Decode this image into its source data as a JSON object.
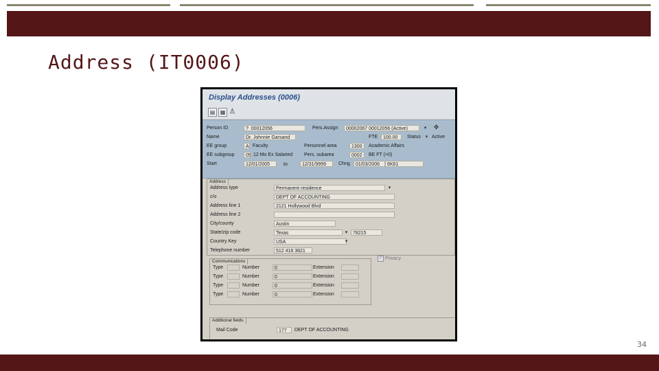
{
  "slide": {
    "title": "Address (IT0006)",
    "page_number": "34"
  },
  "screen": {
    "title": "Display Addresses (0006)",
    "toolbar_icons": [
      "copy-icon",
      "overview-icon",
      "person-icon"
    ],
    "header": {
      "person_id_label": "Person ID",
      "person_id_value": "?_00012056",
      "pers_assign_label": "Pers.Assign",
      "pers_assign_value": "00002067 00012056 (Active)",
      "name_label": "Name",
      "name_value": "Dr. Johnnie Garsand",
      "fte_label": "FTE",
      "fte_value": "100.00",
      "status_label": "Status",
      "status_value": "Active",
      "ee_group_label": "EE group",
      "ee_group_code": "A",
      "ee_group_value": "Faculty",
      "personnel_area_label": "Personnel area",
      "personnel_area_code": "1300",
      "personnel_area_value": "Academic Affairs",
      "ee_subgroup_label": "EE subgroup",
      "ee_subgroup_code": "05",
      "ee_subgroup_value": "12 Mo Ex Salaried",
      "pers_subarea_label": "Pers. subarea",
      "pers_subarea_code": "0002",
      "pers_subarea_value": "BE FT (>0)",
      "start_label": "Start",
      "start_value": "12/01/2005",
      "to_label": "to",
      "to_value": "12/31/9999",
      "chng_label": "Chng",
      "chng_value": "01/03/2006",
      "chng_user": "6K61"
    },
    "address": {
      "group_label": "Address",
      "address_type_label": "Address type",
      "address_type_value": "Permanent residence",
      "co_label": "c/o",
      "co_value": "DEPT OF ACCOUNTING",
      "line1_label": "Address line 1",
      "line1_value": "2121 Hollywood Blvd",
      "line2_label": "Address line 2",
      "line2_value": "",
      "city_label": "City/county",
      "city_value": "Austin",
      "state_label": "State/zip code",
      "state_value": "Texas",
      "zip_value": "78215",
      "country_label": "Country Key",
      "country_value": "USA",
      "phone_label": "Telephone number",
      "phone_value": "512 418 3821"
    },
    "communications": {
      "group_label": "Communications",
      "privacy_label": "Privacy",
      "type_label": "Type",
      "number_label": "Number",
      "extension_label": "Extension",
      "rows": [
        {
          "number": "0"
        },
        {
          "number": "0"
        },
        {
          "number": "0"
        },
        {
          "number": "0"
        }
      ]
    },
    "additional": {
      "group_label": "Additional fields",
      "mail_code_label": "Mail Code",
      "mail_code_code": "177",
      "mail_code_value": "DEPT OF ACCOUNTING"
    }
  }
}
